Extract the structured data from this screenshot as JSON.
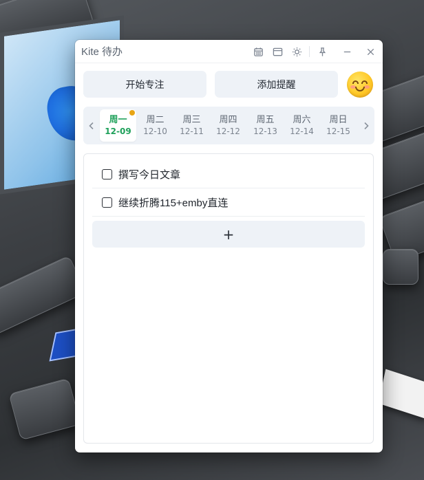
{
  "window": {
    "title": "Kite 待办"
  },
  "title_controls": [
    {
      "name": "calendar-icon"
    },
    {
      "name": "window-icon"
    },
    {
      "name": "sun-icon"
    },
    {
      "name": "pin-icon"
    },
    {
      "name": "minimize-icon"
    },
    {
      "name": "close-icon"
    }
  ],
  "actions": {
    "focus_label": "开始专注",
    "remind_label": "添加提醒",
    "avatar": "smiling-face-emoji"
  },
  "week": {
    "prev_icon": "chevron-left-icon",
    "next_icon": "chevron-right-icon",
    "days": [
      {
        "name": "周一",
        "date": "12-09",
        "selected": true,
        "has_dot": true
      },
      {
        "name": "周二",
        "date": "12-10",
        "selected": false
      },
      {
        "name": "周三",
        "date": "12-11",
        "selected": false
      },
      {
        "name": "周四",
        "date": "12-12",
        "selected": false
      },
      {
        "name": "周五",
        "date": "12-13",
        "selected": false
      },
      {
        "name": "周六",
        "date": "12-14",
        "selected": false
      },
      {
        "name": "周日",
        "date": "12-15",
        "selected": false
      }
    ]
  },
  "todos": [
    {
      "text": "撰写今日文章",
      "checked": false
    },
    {
      "text": "继续折腾115+emby直连",
      "checked": false
    }
  ],
  "add_label": "+",
  "colors": {
    "accent_green": "#1ea05a",
    "dot_orange": "#e8a515",
    "button_bg": "#eef2f7"
  }
}
